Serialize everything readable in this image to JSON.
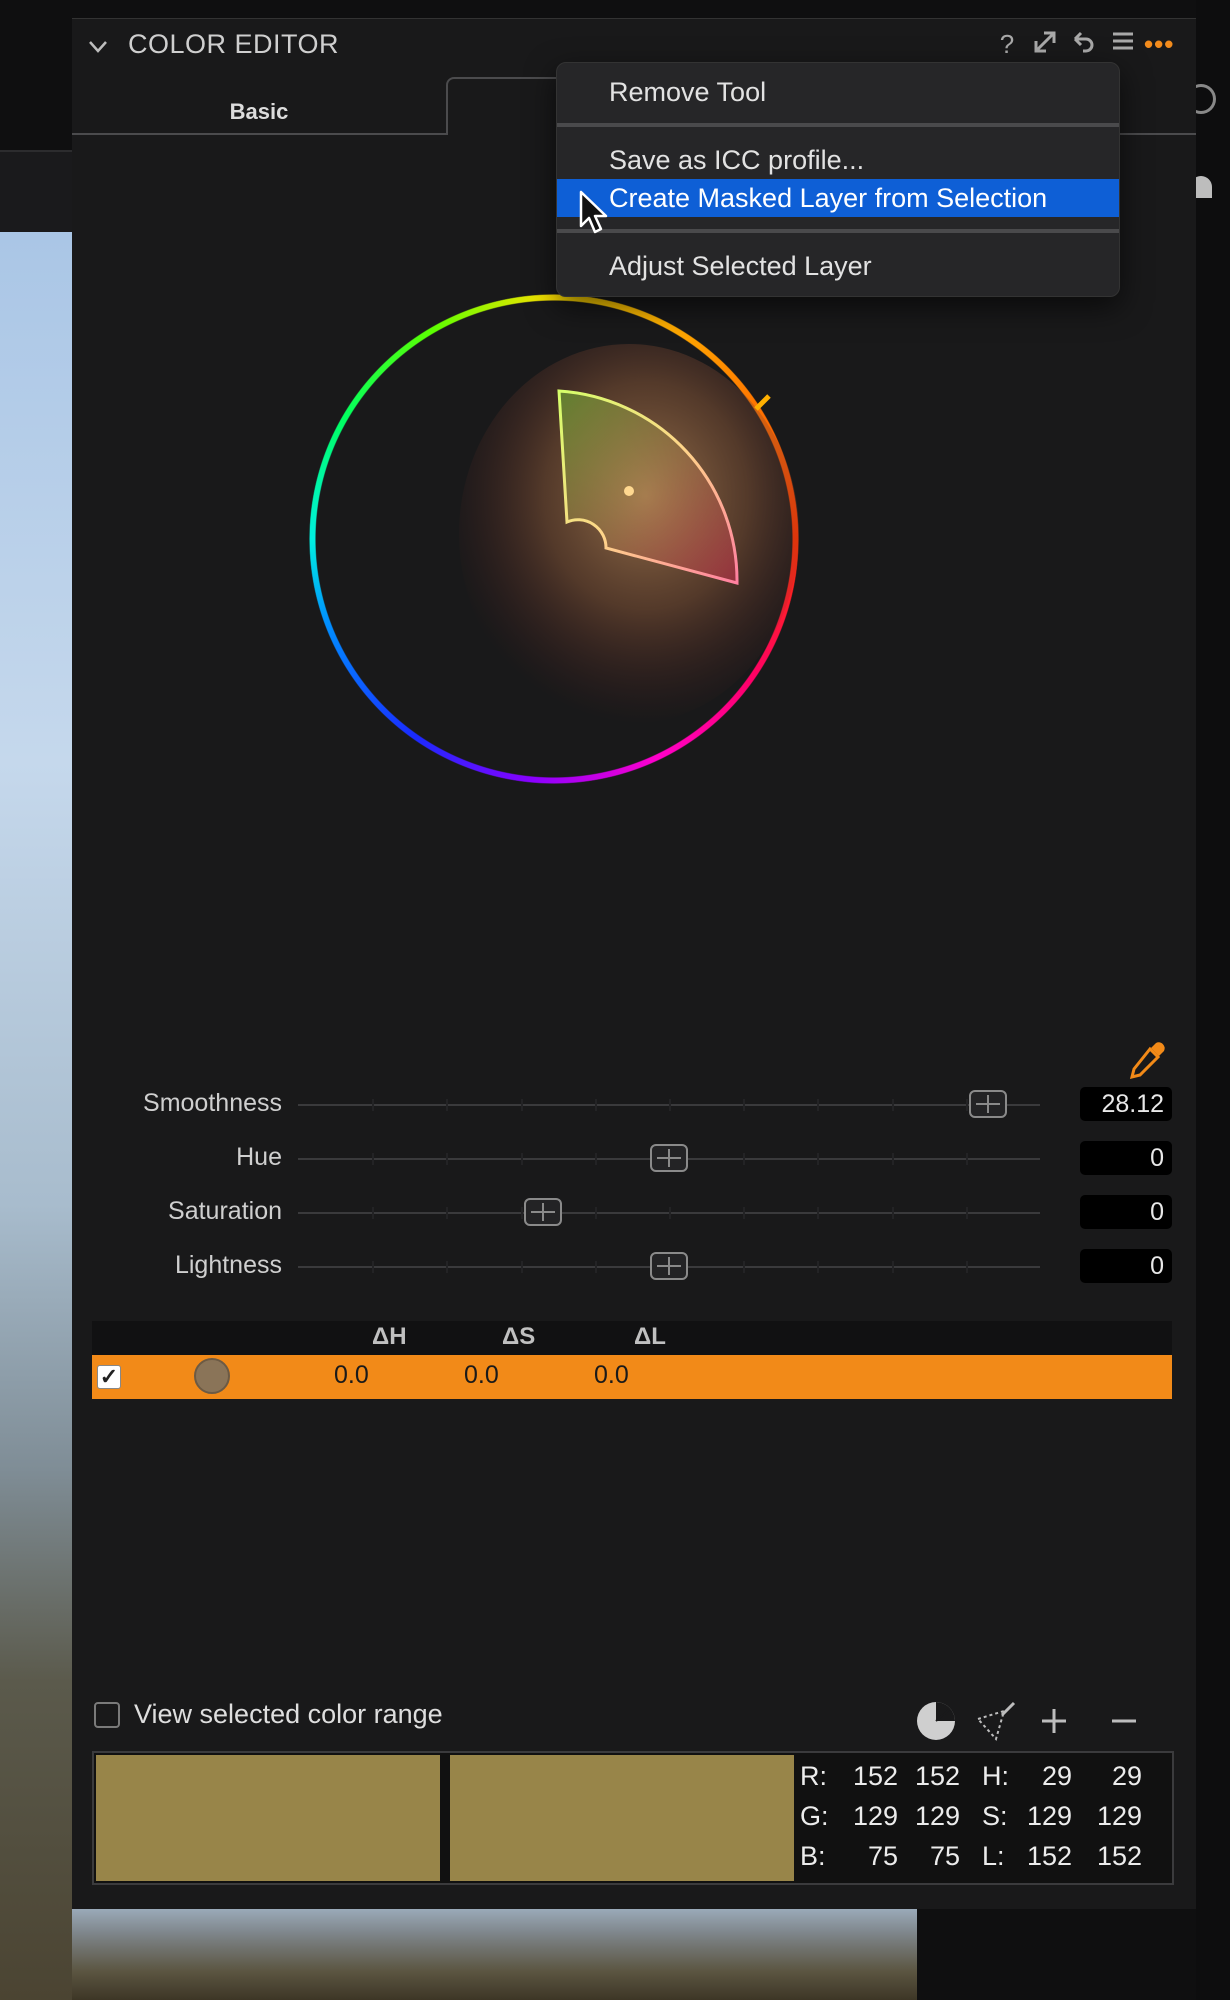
{
  "panel": {
    "title": "COLOR EDITOR",
    "header_icons": [
      "help-icon",
      "expand-icon",
      "reset-icon",
      "list-icon",
      "more-icon"
    ],
    "more_label": "•••"
  },
  "tabs": {
    "basic": "Basic"
  },
  "menu": {
    "items": [
      {
        "label": "Remove Tool"
      },
      {
        "label": "Save as ICC profile..."
      },
      {
        "label": "Create Masked Layer from Selection",
        "selected": true
      },
      {
        "label": "Adjust Selected Layer"
      }
    ]
  },
  "sliders": [
    {
      "label": "Smoothness",
      "value": "28.12",
      "position": 0.93
    },
    {
      "label": "Hue",
      "value": "0",
      "position": 0.5
    },
    {
      "label": "Saturation",
      "value": "0",
      "position": 0.33
    },
    {
      "label": "Lightness",
      "value": "0",
      "position": 0.5
    }
  ],
  "list": {
    "headers": [
      "ΔH",
      "ΔS",
      "ΔL"
    ],
    "row": {
      "checked": true,
      "dh": "0.0",
      "ds": "0.0",
      "dl": "0.0",
      "swatch_color": "#8a7458"
    }
  },
  "bottom": {
    "view_label": "View selected color range",
    "icons": [
      "color-wheel-icon",
      "mask-picker-icon",
      "add-icon",
      "remove-icon"
    ],
    "swatch_color_a": "#988549",
    "swatch_color_b": "#988549"
  },
  "readout": {
    "R": {
      "label": "R:",
      "a": "152",
      "b": "152"
    },
    "G": {
      "label": "G:",
      "a": "129",
      "b": "129"
    },
    "B": {
      "label": "B:",
      "a": "75",
      "b": "75"
    },
    "H": {
      "label": "H:",
      "a": "29",
      "b": "29"
    },
    "S": {
      "label": "S:",
      "a": "129",
      "b": "129"
    },
    "L": {
      "label": "L:",
      "a": "152",
      "b": "152"
    }
  },
  "colors": {
    "accent": "#f28a18",
    "selection": "#0e5fd6",
    "panel_bg": "#19191a"
  }
}
